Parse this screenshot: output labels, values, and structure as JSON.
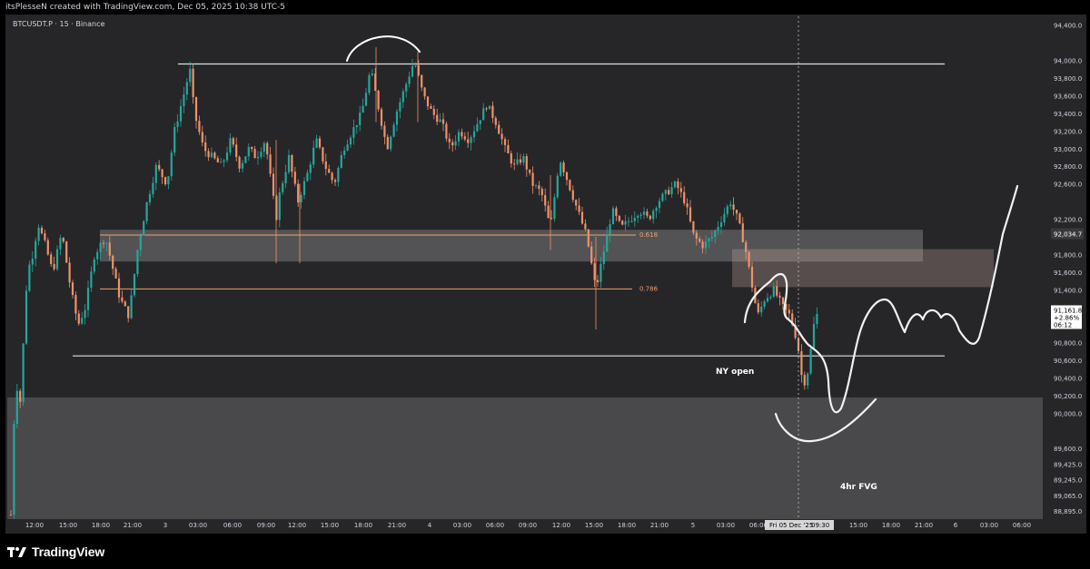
{
  "header": {
    "credit": "itsPlesseN created with TradingView.com, Dec 05, 2025 10:38 UTC-5"
  },
  "symbol_bar": {
    "legend": "BTCUSDT.P · 15 · Binance"
  },
  "chart_data": {
    "type": "candlestick",
    "symbol": "BTCUSDT.P",
    "interval": "15",
    "exchange": "Binance",
    "ylim": [
      88800,
      94500
    ],
    "x_ticks": [
      "12:00",
      "15:00",
      "18:00",
      "21:00",
      "3",
      "03:00",
      "06:00",
      "09:00",
      "12:00",
      "15:00",
      "18:00",
      "21:00",
      "4",
      "03:00",
      "06:00",
      "09:00",
      "12:00",
      "15:00",
      "18:00",
      "21:00",
      "5",
      "03:00",
      "06:00",
      "15:00",
      "18:00",
      "21:00",
      "6",
      "03:00",
      "06:00"
    ],
    "y_ticks": [
      "94,400.0",
      "94,000.0",
      "93,800.0",
      "93,600.0",
      "93,400.0",
      "93,200.0",
      "93,000.0",
      "92,800.0",
      "92,600.0",
      "92,200.0",
      "91,800.0",
      "91,600.0",
      "91,400.0",
      "90,800.0",
      "90,600.0",
      "90,400.0",
      "90,200.0",
      "90,000.0",
      "89,600.0",
      "89,425.0",
      "89,245.0",
      "89,065.0",
      "88,895.0"
    ],
    "y_tick_values": [
      94400,
      94000,
      93800,
      93600,
      93400,
      93200,
      93000,
      92800,
      92600,
      92200,
      91800,
      91600,
      91400,
      90800,
      90600,
      90400,
      90200,
      90000,
      89600,
      89425,
      89245,
      89065,
      88895
    ],
    "price_label": {
      "value": 92034.7,
      "text": "92,034.7"
    },
    "last_price": {
      "price": "91,161.8",
      "change": "+2.86%",
      "countdown": "06:12",
      "value": 91161.8
    },
    "crosshair": {
      "x_label": "Fri 05 Dec '25",
      "x_time": "09:30"
    },
    "levels": [
      {
        "name": "range-high",
        "price": 93960
      },
      {
        "name": "range-low",
        "price": 90650
      },
      {
        "name": "fib-0.618",
        "price": 92020,
        "label": "0.618"
      },
      {
        "name": "fib-0.786",
        "price": 91410,
        "label": "0.786"
      }
    ],
    "zones": [
      {
        "name": "supply-zone-grey",
        "top": 92080,
        "bottom": 91720
      },
      {
        "name": "supply-zone-pink",
        "top": 91860,
        "bottom": 91430
      },
      {
        "name": "4hr-fvg-zone",
        "top": 90180,
        "bottom": 88800
      }
    ],
    "annotations": {
      "ny_open": "NY open",
      "fvg": "4hr FVG"
    },
    "colors": {
      "up": "#26a69a",
      "down": "#f0916a",
      "level": "#e0e0e0",
      "fib": "#f0a070"
    },
    "candle_keyframes": [
      [
        0,
        88850
      ],
      [
        5,
        90400
      ],
      [
        10,
        90100
      ],
      [
        18,
        91600
      ],
      [
        24,
        91800
      ],
      [
        30,
        92150
      ],
      [
        38,
        91900
      ],
      [
        46,
        91600
      ],
      [
        56,
        92050
      ],
      [
        66,
        91400
      ],
      [
        74,
        91000
      ],
      [
        82,
        91200
      ],
      [
        92,
        91800
      ],
      [
        104,
        92000
      ],
      [
        112,
        91650
      ],
      [
        120,
        91300
      ],
      [
        130,
        91100
      ],
      [
        140,
        91900
      ],
      [
        150,
        92400
      ],
      [
        160,
        92800
      ],
      [
        172,
        92600
      ],
      [
        180,
        93200
      ],
      [
        190,
        93600
      ],
      [
        197,
        93900
      ],
      [
        202,
        93400
      ],
      [
        212,
        93000
      ],
      [
        222,
        92900
      ],
      [
        232,
        92800
      ],
      [
        242,
        93100
      ],
      [
        252,
        92800
      ],
      [
        262,
        93000
      ],
      [
        270,
        92900
      ],
      [
        280,
        93100
      ],
      [
        292,
        92200
      ],
      [
        296,
        92500
      ],
      [
        306,
        92900
      ],
      [
        316,
        92400
      ],
      [
        326,
        92700
      ],
      [
        336,
        93100
      ],
      [
        346,
        92800
      ],
      [
        356,
        92600
      ],
      [
        366,
        93000
      ],
      [
        376,
        93200
      ],
      [
        386,
        93400
      ],
      [
        396,
        93900
      ],
      [
        404,
        93500
      ],
      [
        414,
        93000
      ],
      [
        424,
        93400
      ],
      [
        434,
        93700
      ],
      [
        444,
        94000
      ],
      [
        454,
        93600
      ],
      [
        464,
        93400
      ],
      [
        474,
        93300
      ],
      [
        484,
        93000
      ],
      [
        494,
        93200
      ],
      [
        504,
        93100
      ],
      [
        514,
        93300
      ],
      [
        524,
        93500
      ],
      [
        534,
        93300
      ],
      [
        544,
        93000
      ],
      [
        554,
        92800
      ],
      [
        564,
        92900
      ],
      [
        574,
        92600
      ],
      [
        584,
        92500
      ],
      [
        594,
        92100
      ],
      [
        604,
        92900
      ],
      [
        614,
        92600
      ],
      [
        624,
        92300
      ],
      [
        634,
        92000
      ],
      [
        644,
        91400
      ],
      [
        652,
        91800
      ],
      [
        662,
        92300
      ],
      [
        672,
        92100
      ],
      [
        682,
        92200
      ],
      [
        692,
        92300
      ],
      [
        702,
        92200
      ],
      [
        712,
        92400
      ],
      [
        722,
        92500
      ],
      [
        732,
        92600
      ],
      [
        742,
        92400
      ],
      [
        752,
        92000
      ],
      [
        762,
        91900
      ],
      [
        772,
        92000
      ],
      [
        782,
        92200
      ],
      [
        792,
        92400
      ],
      [
        800,
        92200
      ],
      [
        808,
        91900
      ],
      [
        815,
        91500
      ],
      [
        822,
        91100
      ],
      [
        830,
        91300
      ],
      [
        840,
        91400
      ],
      [
        850,
        91200
      ],
      [
        858,
        91100
      ],
      [
        866,
        90800
      ],
      [
        872,
        90300
      ],
      [
        878,
        90500
      ],
      [
        884,
        91000
      ],
      [
        890,
        91200
      ]
    ]
  }
}
